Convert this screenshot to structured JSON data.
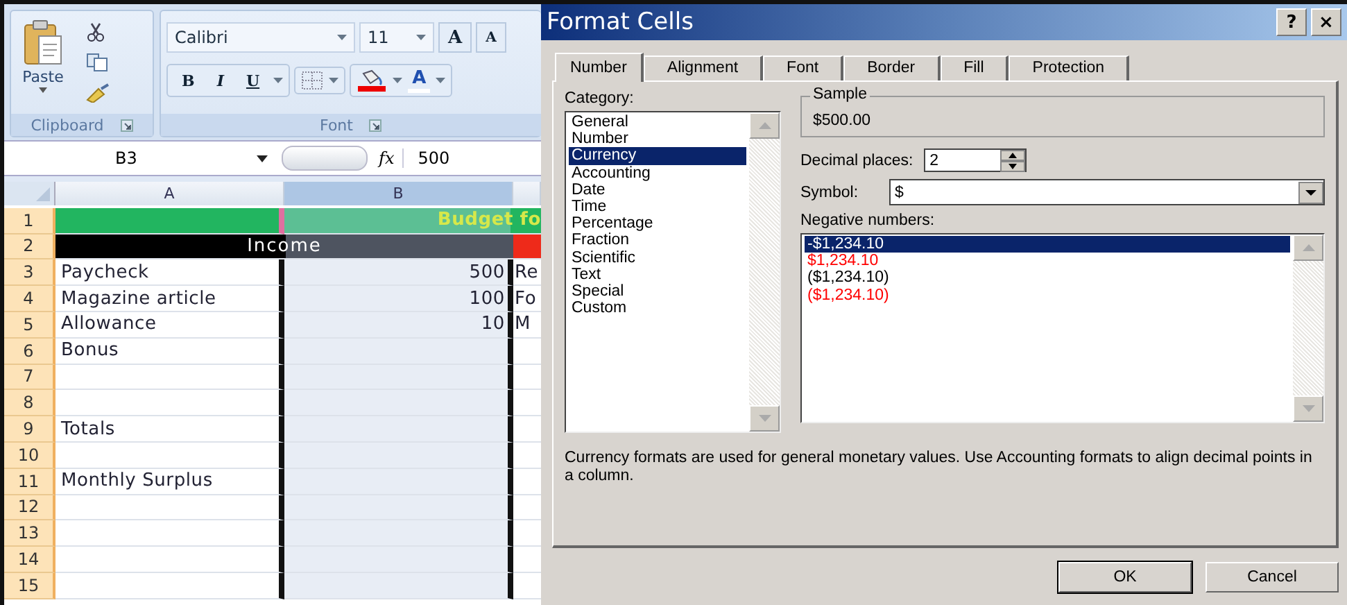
{
  "ribbon": {
    "clipboard": {
      "paste_label": "Paste",
      "group_label": "Clipboard"
    },
    "font": {
      "font_name": "Calibri",
      "font_size": "11",
      "grow_label": "A",
      "shrink_label": "A",
      "style_buttons": [
        "B",
        "I",
        "U"
      ],
      "font_color_label": "A",
      "group_label": "Font"
    }
  },
  "formula_bar": {
    "name_box": "B3",
    "fx_label": "fx",
    "value": "500"
  },
  "sheet": {
    "columns": [
      {
        "label": "A",
        "selected": false
      },
      {
        "label": "B",
        "selected": true
      }
    ],
    "rows": [
      {
        "number": "1",
        "kind": "title",
        "text": "Budget fo"
      },
      {
        "number": "2",
        "kind": "header",
        "text": "Income"
      },
      {
        "number": "3",
        "kind": "data",
        "label": "Paycheck",
        "amount": "500",
        "column_3": "Re"
      },
      {
        "number": "4",
        "kind": "data",
        "label": "Magazine article",
        "amount": "100",
        "column_3": "Fo"
      },
      {
        "number": "5",
        "kind": "data",
        "label": "Allowance",
        "amount": "10",
        "column_3": "M"
      },
      {
        "number": "6",
        "kind": "data",
        "label": "Bonus"
      },
      {
        "number": "7",
        "kind": "data"
      },
      {
        "number": "8",
        "kind": "data"
      },
      {
        "number": "9",
        "kind": "data",
        "label": "Totals"
      },
      {
        "number": "10",
        "kind": "data"
      },
      {
        "number": "11",
        "kind": "data",
        "label": "Monthly Surplus"
      },
      {
        "number": "12",
        "kind": "data"
      },
      {
        "number": "13",
        "kind": "data"
      },
      {
        "number": "14",
        "kind": "data"
      },
      {
        "number": "15",
        "kind": "data"
      }
    ]
  },
  "dialog": {
    "title": "Format Cells",
    "help_button": "?",
    "close_button": "×",
    "tabs": [
      {
        "label": "Number",
        "selected": true
      },
      {
        "label": "Alignment",
        "selected": false
      },
      {
        "label": "Font",
        "selected": false
      },
      {
        "label": "Border",
        "selected": false
      },
      {
        "label": "Fill",
        "selected": false
      },
      {
        "label": "Protection",
        "selected": false
      }
    ],
    "category_label": "Category:",
    "categories": [
      {
        "label": "General",
        "selected": false
      },
      {
        "label": "Number",
        "selected": false
      },
      {
        "label": "Currency",
        "selected": true
      },
      {
        "label": "Accounting",
        "selected": false
      },
      {
        "label": "Date",
        "selected": false
      },
      {
        "label": "Time",
        "selected": false
      },
      {
        "label": "Percentage",
        "selected": false
      },
      {
        "label": "Fraction",
        "selected": false
      },
      {
        "label": "Scientific",
        "selected": false
      },
      {
        "label": "Text",
        "selected": false
      },
      {
        "label": "Special",
        "selected": false
      },
      {
        "label": "Custom",
        "selected": false
      }
    ],
    "sample_label": "Sample",
    "sample_value": "$500.00",
    "decimal_places_label": "Decimal places:",
    "decimal_places": "2",
    "symbol_label": "Symbol:",
    "symbol": "$",
    "negative_numbers_label": "Negative numbers:",
    "negative_numbers": [
      {
        "label": "-$1,234.10",
        "selected": true
      },
      {
        "label": "$1,234.10",
        "color": "#ff0000",
        "selected": false
      },
      {
        "label": "($1,234.10)",
        "color": "#000000",
        "selected": false
      },
      {
        "label": "($1,234.10)",
        "color": "#ff0000",
        "selected": false
      }
    ],
    "description": "Currency formats are used for general monetary values.  Use Accounting formats to align decimal points in a column.",
    "buttons": [
      "OK",
      "Cancel"
    ]
  }
}
